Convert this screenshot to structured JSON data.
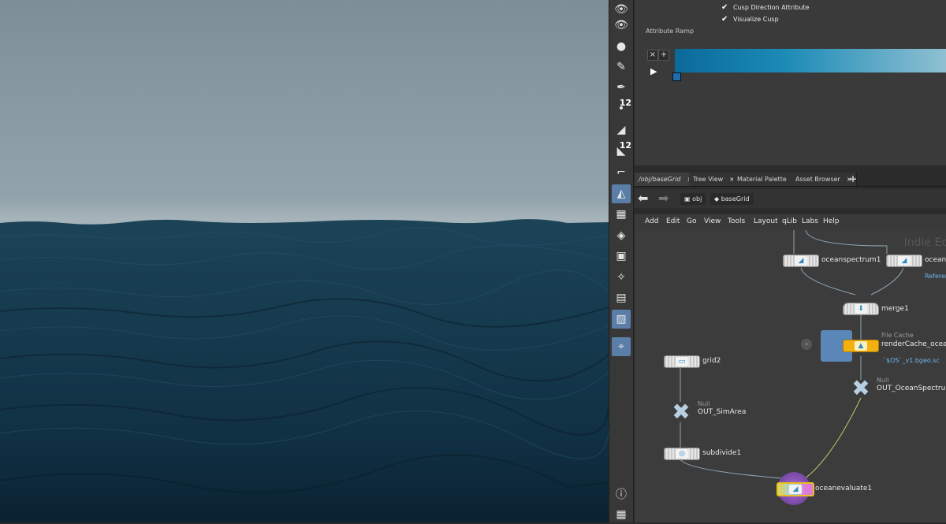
{
  "params": {
    "checkbox1": "Cusp Direction Attribute",
    "checkbox2": "Visualize Cusp",
    "ramp_label": "Attribute Ramp",
    "ramp_remove": "×",
    "ramp_add": "+"
  },
  "toolbar": {
    "badge1": "12",
    "badge2": "12"
  },
  "tabs": [
    {
      "label": "/obj/baseGrid",
      "close": "×"
    },
    {
      "label": "Tree View",
      "close": "×"
    },
    {
      "label": "Material Palette",
      "close": "×"
    },
    {
      "label": "Asset Browser",
      "close": "×"
    },
    {
      "label": "+"
    }
  ],
  "path": {
    "back": "⬅",
    "forward": "➡",
    "crumb1": "obj",
    "crumb2": "baseGrid"
  },
  "menu": [
    "Add",
    "Edit",
    "Go",
    "View",
    "Tools",
    "Layout",
    "qLib",
    "Labs",
    "Help"
  ],
  "network": {
    "watermark": "Indie Ec",
    "nodes": {
      "oceanspectrum1": "oceanspectrum1",
      "ocean2": "ocean",
      "ocean2_sub": "Referen",
      "merge1": "merge1",
      "filecache_type": "File Cache",
      "rendercache": "renderCache_ocea",
      "rendercache_sub": "`$OS`_v1.bgeo.sc",
      "null1_type": "Null",
      "out_ocean": "OUT_OceanSpectrum",
      "grid2": "grid2",
      "null2_type": "Null",
      "out_sim": "OUT_SimArea",
      "subdivide1": "subdivide1",
      "oceanevaluate1": "oceanevaluate1"
    }
  },
  "colors": {
    "ramp_start": "#0a6a9a",
    "ramp_end": "#8fc0d2",
    "filecache": "#f2b10e",
    "ocean_dark": "#0d2b3b"
  }
}
